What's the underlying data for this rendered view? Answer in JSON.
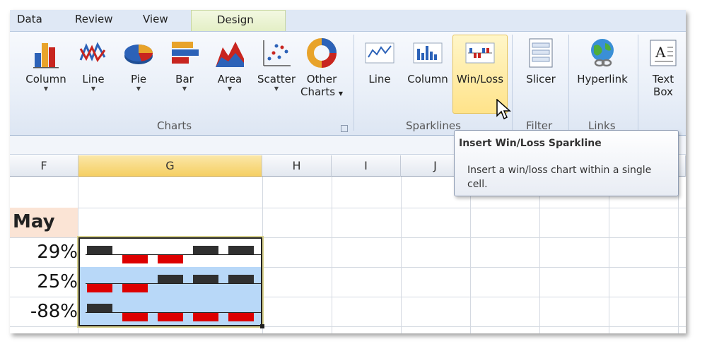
{
  "tabs": {
    "data": "Data",
    "review": "Review",
    "view": "View",
    "design": "Design"
  },
  "charts_group": {
    "label": "Charts",
    "buttons": [
      {
        "label": "Column",
        "icon": "column-chart-icon"
      },
      {
        "label": "Line",
        "icon": "line-chart-icon"
      },
      {
        "label": "Pie",
        "icon": "pie-chart-icon"
      },
      {
        "label": "Bar",
        "icon": "bar-chart-icon"
      },
      {
        "label": "Area",
        "icon": "area-chart-icon"
      },
      {
        "label": "Scatter",
        "icon": "scatter-chart-icon"
      },
      {
        "label1": "Other",
        "label2": "Charts",
        "icon": "other-charts-icon"
      }
    ]
  },
  "sparklines_group": {
    "label": "Sparklines",
    "buttons": [
      {
        "label": "Line",
        "icon": "sparkline-line-icon"
      },
      {
        "label": "Column",
        "icon": "sparkline-column-icon"
      },
      {
        "label": "Win/Loss",
        "icon": "sparkline-winloss-icon"
      }
    ]
  },
  "filter_group": {
    "label": "Filter",
    "button": "Slicer"
  },
  "links_group": {
    "label": "Links",
    "button": "Hyperlink"
  },
  "text_group": {
    "label1": "Text",
    "label2": "Box"
  },
  "columns": [
    "F",
    "G",
    "H",
    "I",
    "J"
  ],
  "sheet": {
    "header": "May",
    "values": [
      "29%",
      "25%",
      "-88%"
    ],
    "winloss": [
      [
        1,
        -1,
        -1,
        1,
        1
      ],
      [
        -1,
        -1,
        1,
        1,
        1
      ],
      [
        1,
        -1,
        -1,
        -1,
        -1
      ]
    ]
  },
  "tooltip": {
    "title": "Insert Win/Loss Sparkline",
    "body": "Insert a win/loss chart within a single cell."
  },
  "colors": {
    "win": "#303030",
    "loss": "#dd0000",
    "selection": "#b8d8f8",
    "active_button": "#ffe38a"
  }
}
